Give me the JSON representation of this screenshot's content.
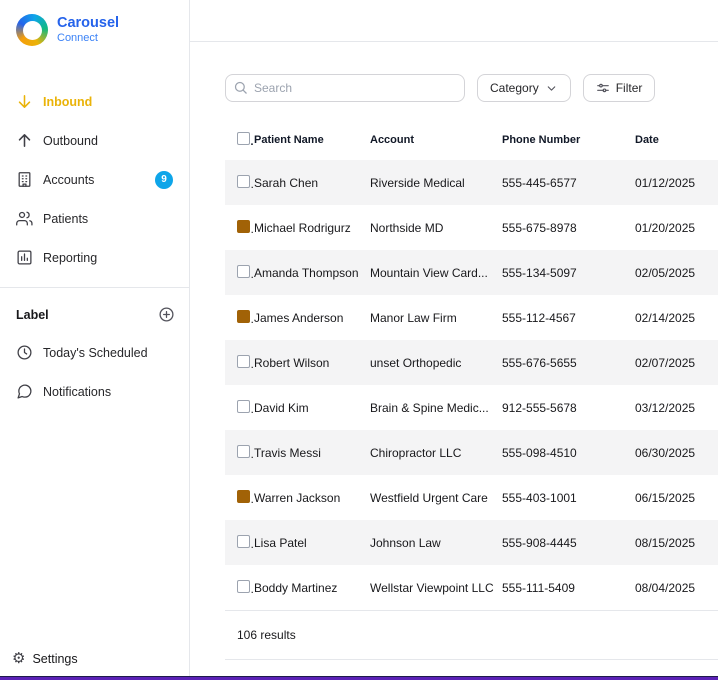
{
  "brand": {
    "name": "Carousel",
    "subtitle": "Connect"
  },
  "sidebar": {
    "items": [
      {
        "label": "Inbound",
        "icon": "arrow-down-icon",
        "active": true
      },
      {
        "label": "Outbound",
        "icon": "arrow-up-icon"
      },
      {
        "label": "Accounts",
        "icon": "building-icon",
        "badge": "9"
      },
      {
        "label": "Patients",
        "icon": "people-icon"
      },
      {
        "label": "Reporting",
        "icon": "bar-chart-icon"
      }
    ],
    "label_section": {
      "title": "Label",
      "action_icon": "add-label-icon"
    },
    "label_items": [
      {
        "label": "Today's Scheduled",
        "icon": "clock-icon"
      },
      {
        "label": "Notifications",
        "icon": "chat-bubble-icon"
      }
    ],
    "settings_label": "Settings"
  },
  "toolbar": {
    "search_placeholder": "Search",
    "category_label": "Category",
    "filter_label": "Filter"
  },
  "table": {
    "columns": [
      "Patient Name",
      "Account",
      "Phone Number",
      "Date"
    ],
    "rows": [
      {
        "name": "Sarah Chen",
        "account": "Riverside Medical",
        "phone": "555-445-6577",
        "date": "01/12/2025",
        "checked": false
      },
      {
        "name": "Michael Rodrigurz",
        "account": "Northside MD",
        "phone": "555-675-8978",
        "date": "01/20/2025",
        "checked": true
      },
      {
        "name": "Amanda Thompson",
        "account": "Mountain View Card...",
        "phone": "555-134-5097",
        "date": "02/05/2025",
        "checked": false
      },
      {
        "name": "James Anderson",
        "account": "Manor Law Firm",
        "phone": "555-112-4567",
        "date": "02/14/2025",
        "checked": true
      },
      {
        "name": "Robert Wilson",
        "account": "unset Orthopedic",
        "phone": "555-676-5655",
        "date": "02/07/2025",
        "checked": false
      },
      {
        "name": "David Kim",
        "account": "Brain & Spine Medic...",
        "phone": "912-555-5678",
        "date": "03/12/2025",
        "checked": false
      },
      {
        "name": "Travis Messi",
        "account": "Chiropractor LLC",
        "phone": "555-098-4510",
        "date": "06/30/2025",
        "checked": false
      },
      {
        "name": "Warren Jackson",
        "account": "Westfield Urgent Care",
        "phone": "555-403-1001",
        "date": "06/15/2025",
        "checked": true
      },
      {
        "name": "Lisa Patel",
        "account": "Johnson Law",
        "phone": "555-908-4445",
        "date": "08/15/2025",
        "checked": false
      },
      {
        "name": "Boddy Martinez",
        "account": "Wellstar Viewpoint LLC",
        "phone": "555-111-5409",
        "date": "08/04/2025",
        "checked": false
      }
    ],
    "footer": "106 results"
  },
  "colors": {
    "accent_amber": "#eab308",
    "checkbox_checked": "#a16207",
    "badge_blue": "#0ea5e9",
    "brand_blue": "#2563eb",
    "bottom_bar": "#5b21b6"
  }
}
